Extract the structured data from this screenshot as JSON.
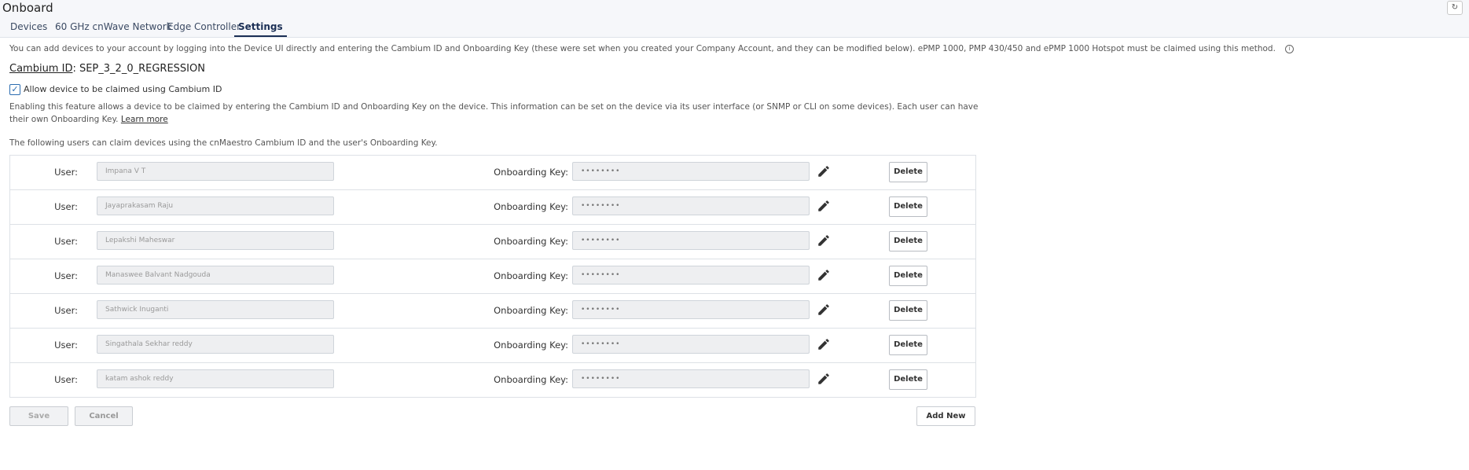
{
  "app": {
    "title": "Onboard",
    "corner_icon": "refresh-icon"
  },
  "tabs": [
    {
      "label": "Devices",
      "active": false
    },
    {
      "label": "60 GHz cnWave Network",
      "active": false
    },
    {
      "label": "Edge Controller",
      "active": false
    },
    {
      "label": "Settings",
      "active": true
    }
  ],
  "info_text": "You can add devices to your account by logging into the Device UI directly and entering the Cambium ID and Onboarding Key (these were set when you created your Company Account, and they can be modified below). ePMP 1000, PMP 430/450 and ePMP 1000 Hotspot must be claimed using this method.",
  "cambium": {
    "label": "Cambium ID",
    "separator": ": ",
    "value": "SEP_3_2_0_REGRESSION"
  },
  "allow_claim": {
    "label": "Allow device to be claimed using Cambium ID",
    "checked": true
  },
  "description": "Enabling this feature allows a device to be claimed by entering the Cambium ID and Onboarding Key on the device. This information can be set on the device via its user interface (or SNMP or CLI on some devices). Each user can have their own Onboarding Key.",
  "learn_more": "Learn more",
  "users_note": "The following users can claim devices using the cnMaestro Cambium ID and the user's Onboarding Key.",
  "table": {
    "user_label": "User:",
    "key_label": "Onboarding Key:",
    "delete_label": "Delete",
    "rows": [
      {
        "user": "Impana V T",
        "key": "••••••••"
      },
      {
        "user": "Jayaprakasam Raju",
        "key": "••••••••"
      },
      {
        "user": "Lepakshi Maheswar",
        "key": "••••••••"
      },
      {
        "user": "Manaswee Balvant Nadgouda",
        "key": "••••••••"
      },
      {
        "user": "Sathwick Inuganti",
        "key": "••••••••"
      },
      {
        "user": "Singathala Sekhar reddy",
        "key": "••••••••"
      },
      {
        "user": "katam ashok reddy",
        "key": "••••••••"
      }
    ]
  },
  "buttons": {
    "save": "Save",
    "cancel": "Cancel",
    "add_new": "Add New"
  },
  "colors": {
    "accent": "#1b2f55",
    "topbar": "#f6f7fa",
    "checkbox": "#2b6cb0"
  }
}
